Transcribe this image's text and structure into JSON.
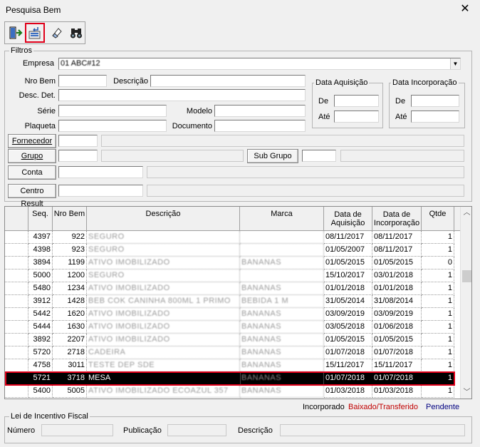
{
  "window": {
    "title": "Pesquisa Bem",
    "close_glyph": "✕"
  },
  "toolbar": {
    "buttons": [
      {
        "name": "exit-icon",
        "selected": false
      },
      {
        "name": "select-return-icon",
        "selected": true
      },
      {
        "name": "eraser-icon",
        "selected": false
      },
      {
        "name": "binoculars-icon",
        "selected": false
      }
    ]
  },
  "filtros": {
    "legend": "Filtros",
    "empresa_label": "Empresa",
    "empresa_value": "01 ABC#12",
    "nro_bem_label": "Nro Bem",
    "nro_bem_value": "",
    "descricao_label": "Descrição",
    "descricao_value": "",
    "desc_det_label": "Desc. Det.",
    "desc_det_value": "",
    "serie_label": "Série",
    "serie_value": "",
    "modelo_label": "Modelo",
    "modelo_value": "",
    "plaqueta_label": "Plaqueta",
    "plaqueta_value": "",
    "documento_label": "Documento",
    "documento_value": "",
    "data_aquisicao": {
      "legend": "Data Aquisição",
      "de_label": "De",
      "ate_label": "Até",
      "de_value": "",
      "ate_value": ""
    },
    "data_incorporacao": {
      "legend": "Data Incorporação",
      "de_label": "De",
      "ate_label": "Até",
      "de_value": "",
      "ate_value": ""
    },
    "fornecedor_button": "Fornecedor",
    "fornecedor_code": "",
    "fornecedor_name": "",
    "grupo_button": "Grupo",
    "grupo_code": "",
    "grupo_name": "",
    "subgrupo_button": "Sub Grupo",
    "subgrupo_code": "",
    "subgrupo_name": "",
    "conta_button": "Conta",
    "conta_code": "",
    "conta_name": "",
    "centro_button": "Centro Result",
    "centro_code": "",
    "centro_name": ""
  },
  "grid": {
    "columns": [
      "Seq.",
      "Nro Bem",
      "Descrição",
      "Marca",
      "Data de Aquisição",
      "Data de Incorporação",
      "Qtde"
    ],
    "col_aquisicao_l1": "Data de",
    "col_aquisicao_l2": "Aquisição",
    "col_incorporacao_l1": "Data de",
    "col_incorporacao_l2": "Incorporação",
    "rows": [
      {
        "seq": "4397",
        "nro": "922",
        "desc": "SEGURO",
        "marca": "",
        "aq": "08/11/2017",
        "inc": "08/11/2017",
        "qtde": "1"
      },
      {
        "seq": "4398",
        "nro": "923",
        "desc": "SEGURO",
        "marca": "",
        "aq": "01/05/2007",
        "inc": "08/11/2017",
        "qtde": "1"
      },
      {
        "seq": "3894",
        "nro": "1199",
        "desc": "ATIVO IMOBILIZADO",
        "marca": "BANANAS",
        "aq": "01/05/2015",
        "inc": "01/05/2015",
        "qtde": "0"
      },
      {
        "seq": "5000",
        "nro": "1200",
        "desc": "SEGURO",
        "marca": "",
        "aq": "15/10/2017",
        "inc": "03/01/2018",
        "qtde": "1"
      },
      {
        "seq": "5480",
        "nro": "1234",
        "desc": "ATIVO IMOBILIZADO",
        "marca": "BANANAS",
        "aq": "01/01/2018",
        "inc": "01/01/2018",
        "qtde": "1"
      },
      {
        "seq": "3912",
        "nro": "1428",
        "desc": "BEB COK CANINHA 800ML 1 PRIMO",
        "marca": "BEBIDA 1 M",
        "aq": "31/05/2014",
        "inc": "31/08/2014",
        "qtde": "1"
      },
      {
        "seq": "5442",
        "nro": "1620",
        "desc": "ATIVO IMOBILIZADO",
        "marca": "BANANAS",
        "aq": "03/09/2019",
        "inc": "03/09/2019",
        "qtde": "1"
      },
      {
        "seq": "5444",
        "nro": "1630",
        "desc": "ATIVO IMOBILIZADO",
        "marca": "BANANAS",
        "aq": "03/05/2018",
        "inc": "01/06/2018",
        "qtde": "1"
      },
      {
        "seq": "3892",
        "nro": "2207",
        "desc": "ATIVO IMOBILIZADO",
        "marca": "BANANAS",
        "aq": "01/05/2015",
        "inc": "01/05/2015",
        "qtde": "1"
      },
      {
        "seq": "5720",
        "nro": "2718",
        "desc": "CADEIRA",
        "marca": "BANANAS",
        "aq": "01/07/2018",
        "inc": "01/07/2018",
        "qtde": "1"
      },
      {
        "seq": "4758",
        "nro": "3011",
        "desc": "TESTE DEP SDE",
        "marca": "BANANAS",
        "aq": "15/11/2017",
        "inc": "15/11/2017",
        "qtde": "1"
      },
      {
        "seq": "5721",
        "nro": "3718",
        "desc": "MESA",
        "marca": "BANANAS",
        "aq": "01/07/2018",
        "inc": "01/07/2018",
        "qtde": "1",
        "selected": true
      },
      {
        "seq": "5400",
        "nro": "5005",
        "desc": "ATIVO IMOBILIZADO ECOAZUL 357",
        "marca": "BANANAS",
        "aq": "01/03/2018",
        "inc": "01/03/2018",
        "qtde": "1"
      }
    ]
  },
  "status_legend": {
    "incorporado": "Incorporado",
    "baixado": "Baixado/Transferido",
    "pendente": "Pendente",
    "incorporado_color": "#000000",
    "baixado_color": "#c00000",
    "pendente_color": "#000080"
  },
  "lei": {
    "legend": "Lei de Incentivo Fiscal",
    "numero_label": "Número",
    "numero_value": "",
    "publicacao_label": "Publicação",
    "publicacao_value": "",
    "descricao_label": "Descrição",
    "descricao_value": ""
  }
}
